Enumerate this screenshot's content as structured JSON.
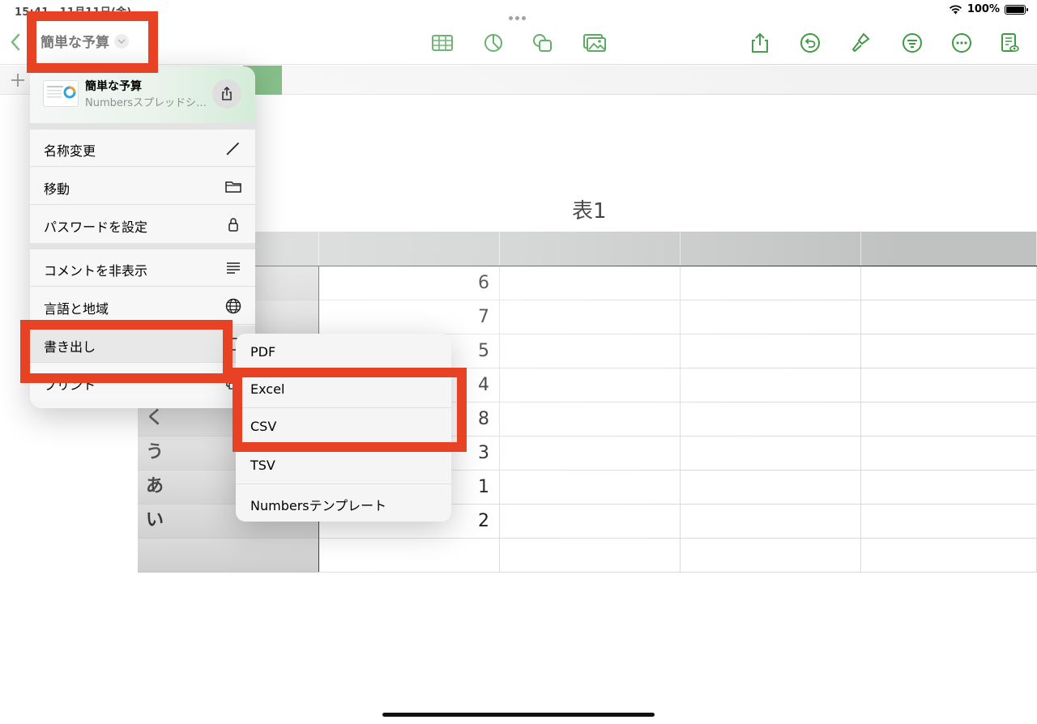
{
  "status": {
    "time": "15:41　11月11日(金)",
    "battery": "100%",
    "battery_level": 1.0
  },
  "toolbar": {
    "title": "簡単な予算",
    "icons": [
      "table-icon",
      "chart-icon",
      "shapes-icon",
      "media-icon",
      "share-icon",
      "undo-icon",
      "format-brush-icon",
      "collaborate-icon",
      "more-icon",
      "reading-view-icon"
    ],
    "accent": "#3f9a44"
  },
  "sheet": {
    "table_title": "表1",
    "rows": [
      {
        "label": "",
        "value": "6"
      },
      {
        "label": "",
        "value": "7"
      },
      {
        "label": "",
        "value": "5"
      },
      {
        "label": "",
        "value": "4"
      },
      {
        "label": "く",
        "value": "8"
      },
      {
        "label": "う",
        "value": "3"
      },
      {
        "label": "あ",
        "value": "1"
      },
      {
        "label": "い",
        "value": "2"
      },
      {
        "label": "",
        "value": ""
      }
    ]
  },
  "menu": {
    "doc_title": "簡単な予算",
    "doc_subtitle": "Numbersスプレッドシート",
    "items": [
      {
        "label": "名称変更",
        "icon": "pencil-icon"
      },
      {
        "label": "移動",
        "icon": "folder-icon"
      },
      {
        "label": "パスワードを設定",
        "icon": "lock-icon"
      },
      {
        "label": "コメントを非表示",
        "icon": "lines-icon"
      },
      {
        "label": "言語と地域",
        "icon": "globe-icon"
      },
      {
        "label": "書き出し",
        "icon": "export-icon"
      },
      {
        "label": "プリント",
        "icon": "printer-icon"
      }
    ]
  },
  "export_menu": {
    "items": [
      "PDF",
      "Excel",
      "CSV",
      "TSV",
      "Numbersテンプレート"
    ]
  },
  "highlight_color": "#e84225"
}
